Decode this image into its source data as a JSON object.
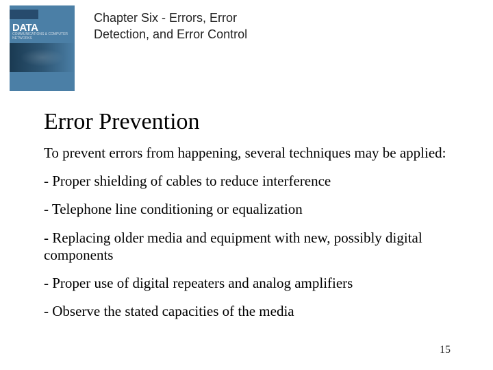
{
  "header": {
    "book": {
      "title_main": "DATA",
      "title_sub": "COMMUNICATIONS\n& COMPUTER NETWORKS"
    },
    "chapter_title": "Chapter Six - Errors, Error Detection, and Error Control"
  },
  "content": {
    "heading": "Error Prevention",
    "intro": "To prevent errors from happening, several techniques may be applied:",
    "bullets": [
      "- Proper shielding of cables to reduce interference",
      "- Telephone line conditioning or equalization",
      "- Replacing older media and equipment with new, possibly digital components",
      "- Proper use of digital repeaters and analog amplifiers",
      "- Observe the stated capacities of the media"
    ]
  },
  "page_number": "15"
}
